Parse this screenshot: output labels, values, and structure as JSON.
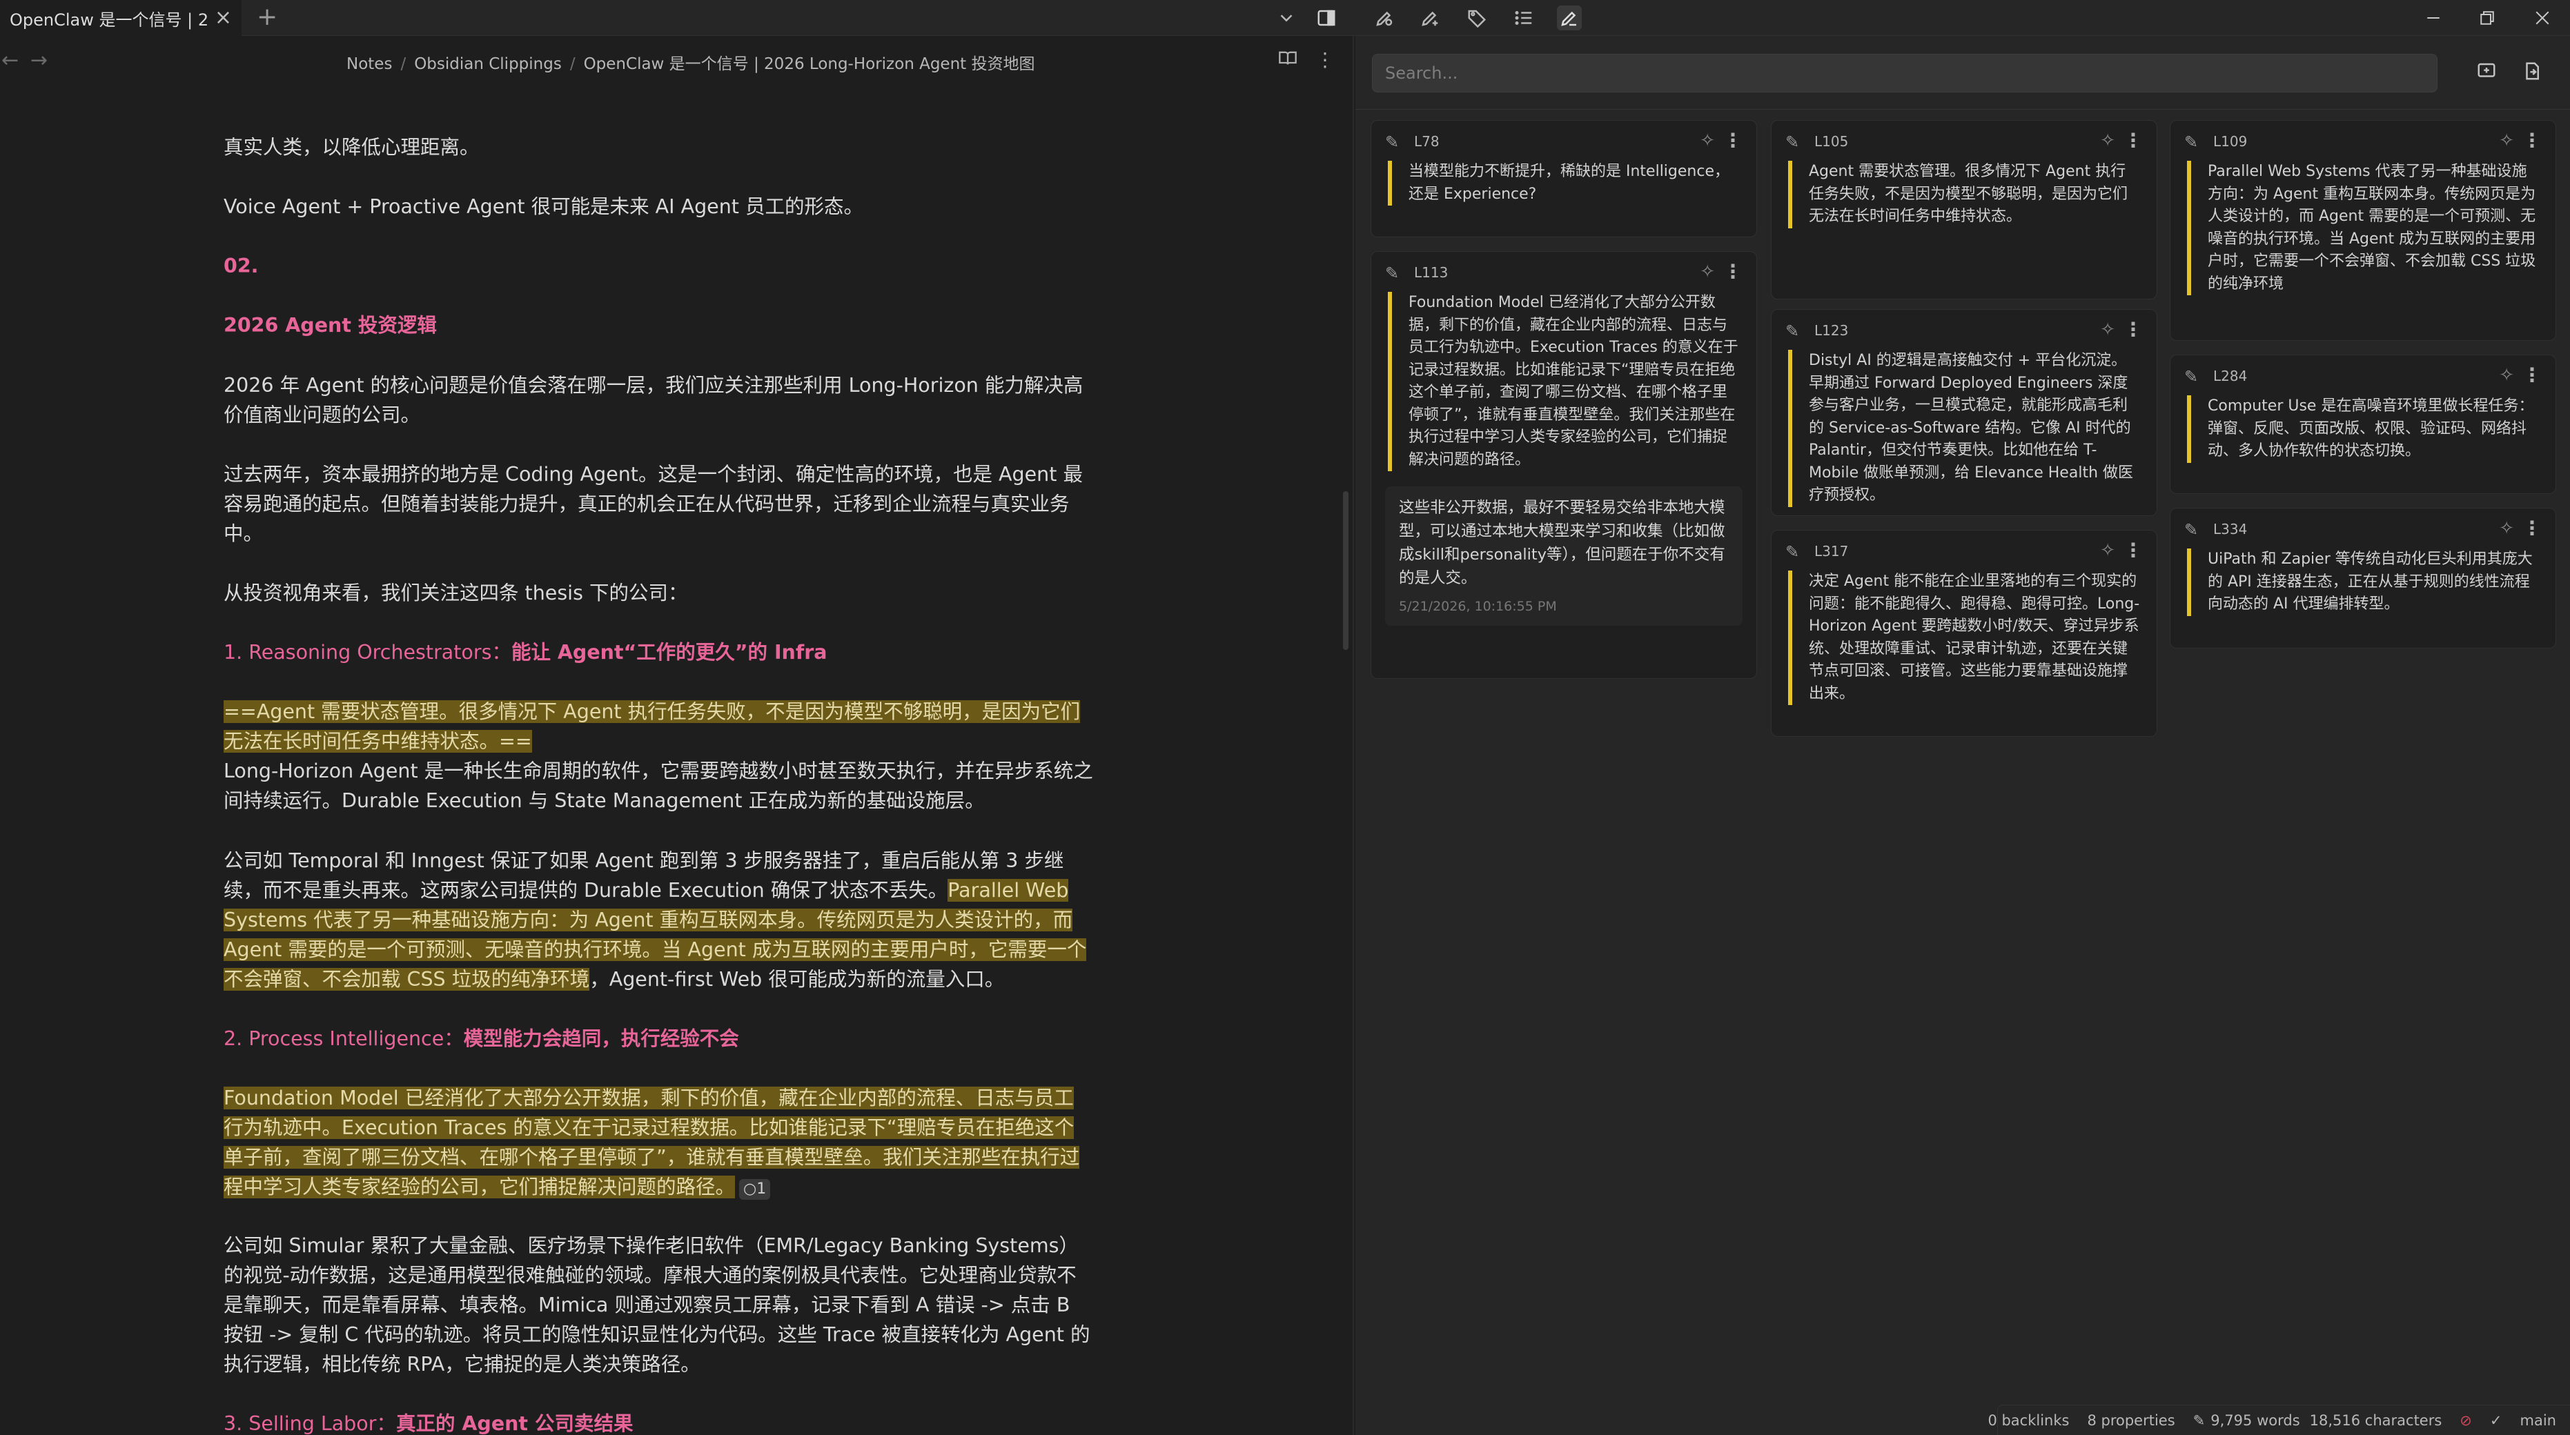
{
  "tab": {
    "title": "OpenClaw 是一个信号 | 2..."
  },
  "breadcrumb": [
    "Notes",
    "Obsidian Clippings",
    "OpenClaw 是一个信号 | 2026 Long-Horizon Agent 投资地图"
  ],
  "document": {
    "p0": "真实人类，以降低心理距离。",
    "p1": "Voice Agent + Proactive Agent 很可能是未来 AI Agent 员工的形态。",
    "h_num": "02.",
    "h_title": "2026 Agent 投资逻辑",
    "p2": "2026 年 Agent 的核心问题是价值会落在哪一层，我们应关注那些利用 Long-Horizon 能力解决高价值商业问题的公司。",
    "p3": "过去两年，资本最拥挤的地方是 Coding Agent。这是一个封闭、确定性高的环境，也是 Agent 最容易跑通的起点。但随着封装能力提升，真正的机会正在从代码世界，迁移到企业流程与真实业务中。",
    "p4": "从投资视角来看，我们关注这四条 thesis 下的公司：",
    "s1_prefix": "1. Reasoning Orchestrators：",
    "s1_title": "能让 Agent“工作的更久”的 Infra",
    "p5_hl": "==Agent 需要状态管理。很多情况下 Agent 执行任务失败，不是因为模型不够聪明，是因为它们无法在长时间任务中维持状态。==",
    "p6": "Long-Horizon Agent 是一种长生命周期的软件，它需要跨越数小时甚至数天执行，并在异步系统之间持续运行。Durable Execution 与 State Management 正在成为新的基础设施层。",
    "p7_a": "公司如 Temporal 和 Inngest 保证了如果 Agent 跑到第 3 步服务器挂了，重启后能从第 3 步继续，而不是重头再来。这两家公司提供的 Durable Execution 确保了状态不丢失。",
    "p7_hl": "Parallel Web Systems 代表了另一种基础设施方向：为 Agent 重构互联网本身。传统网页是为人类设计的，而 Agent 需要的是一个可预测、无噪音的执行环境。当 Agent 成为互联网的主要用户时，它需要一个不会弹窗、不会加载 CSS 垃圾的纯净环境",
    "p7_b": "，Agent-first Web 很可能成为新的流量入口。",
    "s2_prefix": "2. Process Intelligence：",
    "s2_title": "模型能力会趋同，执行经验不会",
    "p8_hl": "Foundation Model 已经消化了大部分公开数据，剩下的价值，藏在企业内部的流程、日志与员工行为轨迹中。Execution Traces 的意义在于记录过程数据。比如谁能记录下“理赔专员在拒绝这个单子前，查阅了哪三份文档、在哪个格子里停顿了”，谁就有垂直模型壁垒。我们关注那些在执行过程中学习人类专家经验的公司，它们捕捉解决问题的路径。",
    "p8_comment_icon": "comment-icon",
    "p8_comment_count": "1",
    "p9": "公司如 Simular 累积了大量金融、医疗场景下操作老旧软件（EMR/Legacy Banking Systems）的视觉-动作数据，这是通用模型很难触碰的领域。摩根大通的案例极具代表性。它处理商业贷款不是靠聊天，而是靠看屏幕、填表格。Mimica 则通过观察员工屏幕，记录下看到 A 错误 -> 点击 B 按钮 -> 复制 C 代码的轨迹。将员工的隐性知识显性化为代码。这些 Trace 被直接转化为 Agent 的执行逻辑，相比传统 RPA，它捕捉的是人类决策路径。",
    "s3_prefix": "3. Selling Labor：",
    "s3_title": "真正的 Agent 公司卖结果"
  },
  "right_pane": {
    "search_placeholder": "Search...",
    "cards": [
      {
        "label": "L78",
        "text": "当模型能力不断提升，稀缺的是 Intelligence，还是 Experience?"
      },
      {
        "label": "L113",
        "text": "Foundation Model 已经消化了大部分公开数据，剩下的价值，藏在企业内部的流程、日志与员工行为轨迹中。Execution Traces 的意义在于记录过程数据。比如谁能记录下“理赔专员在拒绝这个单子前，查阅了哪三份文档、在哪个格子里停顿了”，谁就有垂直模型壁垒。我们关注那些在执行过程中学习人类专家经验的公司，它们捕捉解决问题的路径。",
        "comment": "这些非公开数据，最好不要轻易交给非本地大模型，可以通过本地大模型来学习和收集（比如做成skill和personality等），但问题在于你不交有的是人交。",
        "comment_time": "5/21/2026, 10:16:55 PM"
      },
      {
        "label": "L105",
        "text": "Agent 需要状态管理。很多情况下 Agent 执行任务失败，不是因为模型不够聪明，是因为它们无法在长时间任务中维持状态。"
      },
      {
        "label": "L123",
        "text": "Distyl AI 的逻辑是高接触交付 + 平台化沉淀。早期通过 Forward Deployed Engineers 深度参与客户业务，一旦模式稳定，就能形成高毛利的 Service-as-Software 结构。它像 AI 时代的 Palantir，但交付节奏更快。比如他在给 T-Mobile 做账单预测，给 Elevance Health 做医疗预授权。"
      },
      {
        "label": "L317",
        "text": "决定 Agent 能不能在企业里落地的有三个现实的问题：能不能跑得久、跑得稳、跑得可控。Long-Horizon Agent 要跨越数小时/数天、穿过异步系统、处理故障重试、记录审计轨迹，还要在关键节点可回滚、可接管。这些能力要靠基础设施撑出来。"
      },
      {
        "label": "L109",
        "text": "Parallel Web Systems 代表了另一种基础设施方向：为 Agent 重构互联网本身。传统网页是为人类设计的，而 Agent 需要的是一个可预测、无噪音的执行环境。当 Agent 成为互联网的主要用户时，它需要一个不会弹窗、不会加载 CSS 垃圾的纯净环境"
      },
      {
        "label": "L284",
        "text": "Computer Use 是在高噪音环境里做长程任务：弹窗、反爬、页面改版、权限、验证码、网络抖动、多人协作软件的状态切换。"
      },
      {
        "label": "L334",
        "text": "UiPath 和 Zapier 等传统自动化巨头利用其庞大的 API 连接器生态，正在从基于规则的线性流程向动态的 AI 代理编排转型。"
      }
    ]
  },
  "status": {
    "backlinks": "0 backlinks",
    "properties": "8 properties",
    "words": "9,795 words",
    "characters": "18,516 characters",
    "branch": "main"
  },
  "colors": {
    "highlight": "#6b5a17",
    "heading": "#e8659a",
    "card_bar": "#e6c52a"
  }
}
